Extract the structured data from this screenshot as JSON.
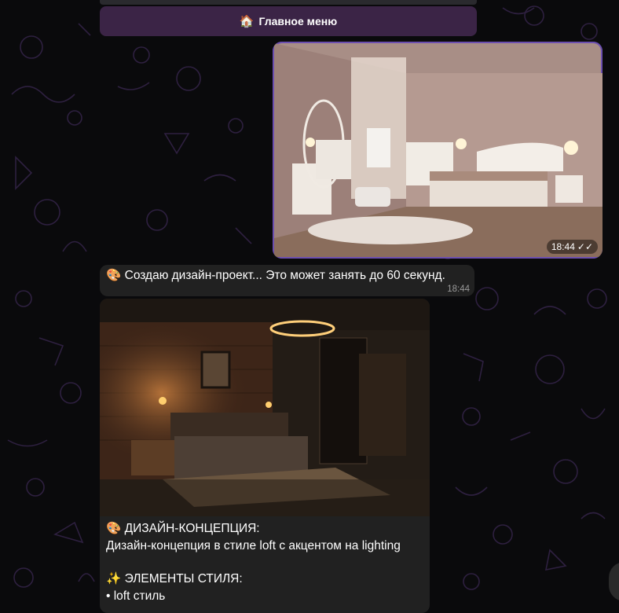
{
  "colors": {
    "background": "#0a0a0c",
    "doodle": "#2e2040",
    "menu_button": "#3b2446",
    "bubble_incoming": "#212121",
    "accent": "#6c4fb0"
  },
  "menu": {
    "icon": "house-emoji",
    "label": "Главное меню"
  },
  "outgoing_photo": {
    "time": "18:44",
    "status": "read-double-check"
  },
  "status_message": {
    "icon": "palette-emoji",
    "text": "Создаю дизайн-проект... Это может занять до 60 секунд.",
    "time": "18:44"
  },
  "concept_message": {
    "heading_icon": "palette-emoji",
    "heading": "ДИЗАЙН-КОНЦЕПЦИЯ:",
    "description": "Дизайн-концепция в стиле loft с акцентом на lighting",
    "elements_icon": "sparkles-emoji",
    "elements_heading": "ЭЛЕМЕНТЫ СТИЛЯ:",
    "elements": [
      "• loft стиль"
    ]
  }
}
